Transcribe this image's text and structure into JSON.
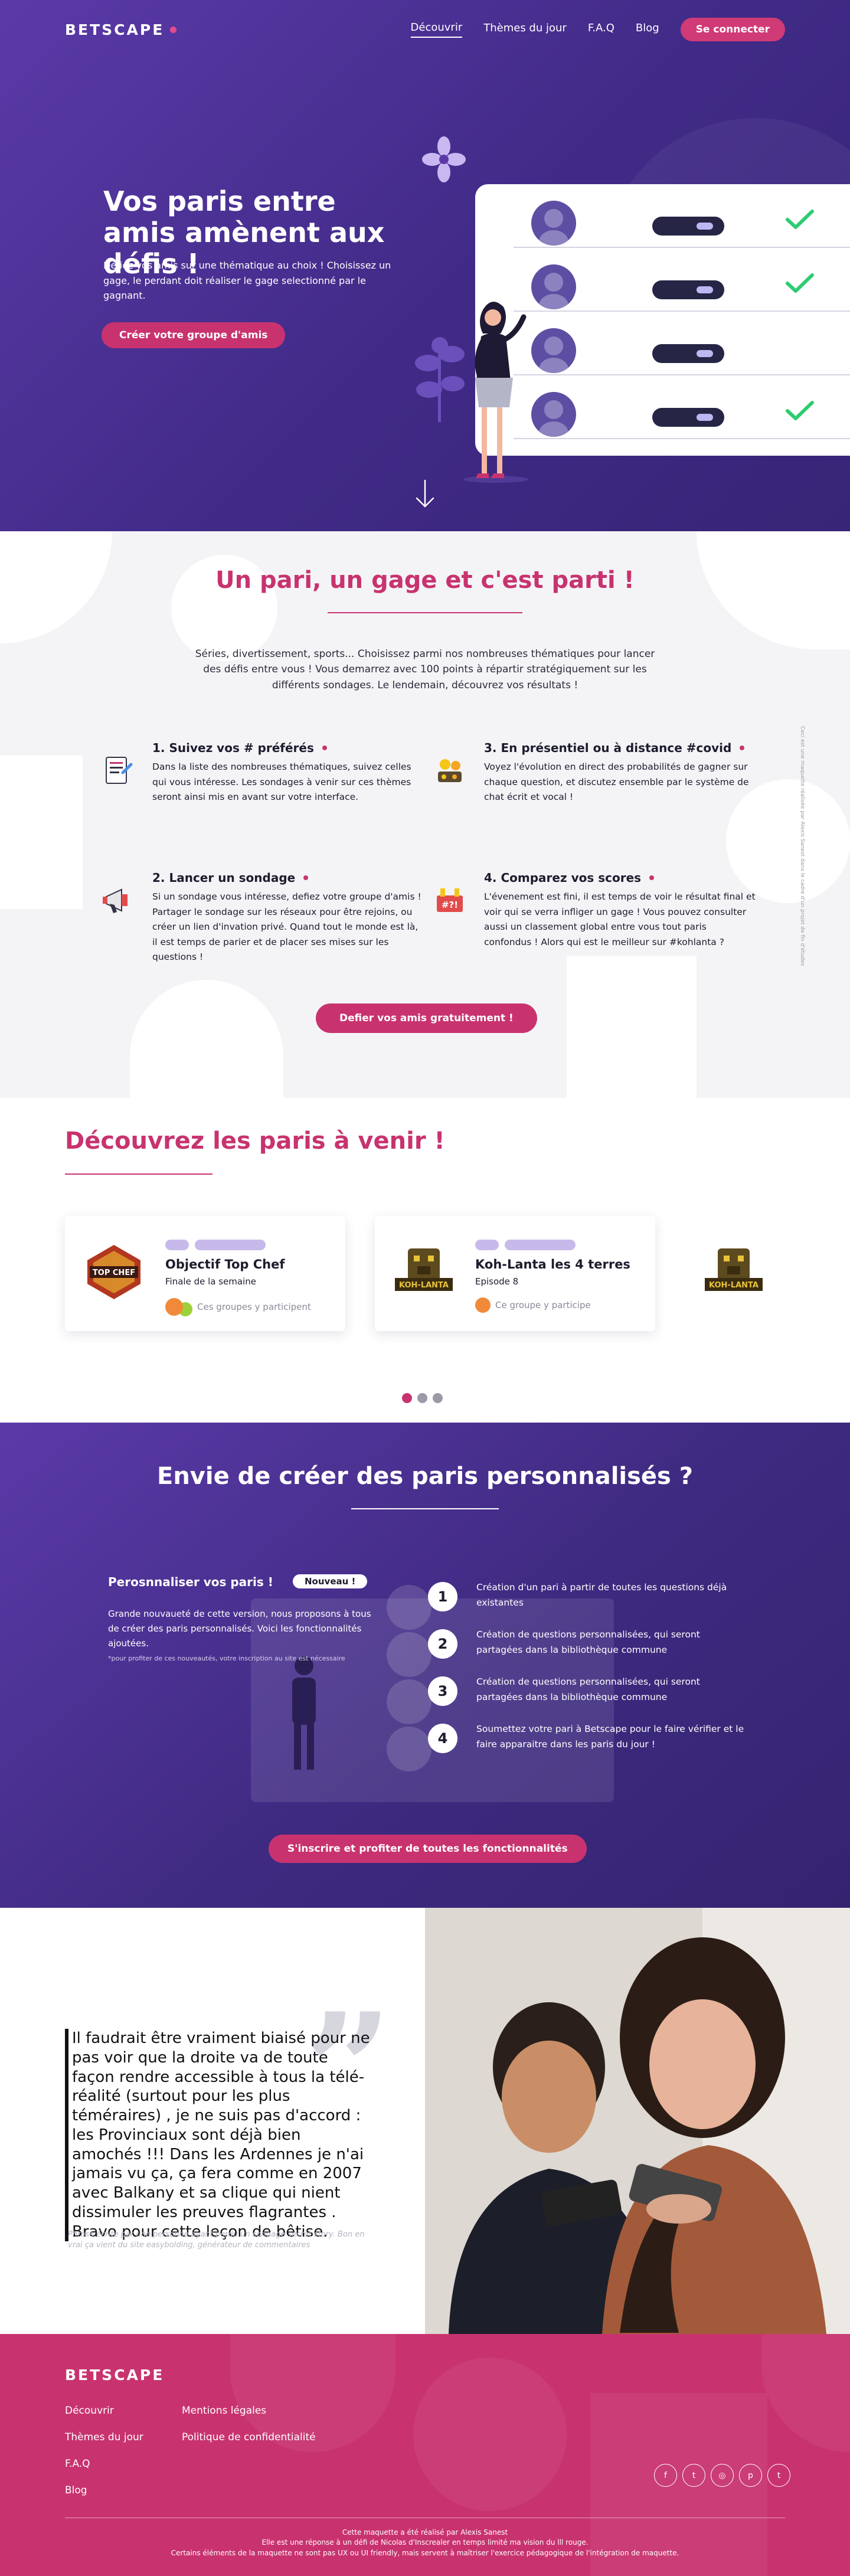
{
  "nav": {
    "logo": "BETSCAPE",
    "links": [
      "Découvrir",
      "Thèmes du jour",
      "F.A.Q",
      "Blog"
    ],
    "cta": "Se connecter"
  },
  "hero": {
    "title": "Vos paris entre amis amènent aux défis !",
    "subtitle": "Défiez vos amis sur une thématique au choix ! Choisissez un gage, le perdant doit réaliser le gage selectionné par le gagnant.",
    "cta": "Créer votre groupe d'amis"
  },
  "features": {
    "title": "Un pari, un gage et c'est parti !",
    "intro": "Séries, divertissement, sports... Choisissez parmi nos nombreuses thématiques pour lancer des défis entre vous ! Vous demarrez avec 100 points à répartir stratégiquement sur les différents sondages. Le lendemain, découvrez vos résultats !",
    "steps": [
      {
        "title": "1. Suivez vos # préférés",
        "text": "Dans la liste des nombreuses thématiques, suivez celles qui vous intéresse. Les sondages à venir sur ces thèmes seront ainsi mis en avant sur votre interface."
      },
      {
        "title": "2. Lancer un sondage",
        "text": "Si un sondage vous intéresse, defiez votre groupe d'amis ! Partager le sondage sur les réseaux pour être rejoins, ou créer un lien d'invation privé. Quand tout le monde est là, il est temps de parier et de placer ses mises sur les questions !"
      },
      {
        "title": "3. En présentiel ou à distance #covid",
        "text": "Voyez l'évolution en direct des probabilités de gagner sur chaque question, et discutez ensemble par le système de chat écrit et vocal !"
      },
      {
        "title": "4. Comparez vos scores",
        "text": "L'évenement est fini, il est temps de voir le résultat final et voir qui se verra infliger un gage ! Vous pouvez consulter aussi un classement global entre vous tout paris confondus ! Alors qui est le meilleur sur #kohlanta ?"
      }
    ],
    "vertical_note": "Ceci est une maquette réalisée par Alexis Sanest dans le cadre d'un projet de fin d'études",
    "cta": "Defier vos amis gratuitement !"
  },
  "upcoming": {
    "title": "Découvrez les paris à venir !",
    "cards": [
      {
        "thumb_text": "TOP CHEF",
        "title": "Objectif Top Chef",
        "subtitle": "Finale de la semaine",
        "meta": "Ces groupes y participent"
      },
      {
        "thumb_text": "KOH-LANTA",
        "title": "Koh-Lanta les 4 terres",
        "subtitle": "Episode 8",
        "meta": "Ce groupe y participe"
      },
      {
        "thumb_text": "KOH-LANTA"
      }
    ]
  },
  "custom": {
    "title": "Envie de créer des paris personnalisés ?",
    "heading": "Perosnnaliser vos paris !",
    "badge": "Nouveau !",
    "desc": "Grande nouvaueté de cette version, nous proposons à tous de créer des paris personnalisés. Voici les fonctionnalités ajoutées.",
    "note": "*pour profiter de ces nouveautés, votre inscription au site est nécessaire",
    "steps": [
      {
        "num": "1",
        "text": "Création d'un pari à partir de toutes les questions déjà existantes"
      },
      {
        "num": "2",
        "text": "Création de questions personnalisées, qui seront partagées dans la bibliothèque commune"
      },
      {
        "num": "3",
        "text": "Création de questions personnalisées, qui seront partagées dans la bibliothèque commune"
      },
      {
        "num": "4",
        "text": "Soumettez votre pari à Betscape pour le faire vérifier et le faire apparaitre dans les paris du jour !"
      }
    ],
    "cta": "S'inscrire et profiter de toutes les fonctionnalités"
  },
  "quote": {
    "text": "Il faudrait être vraiment biaisé pour ne pas voir que la droite va de toute façon rendre accessible à tous la télé-réalité (surtout pour les plus téméraires) , je ne suis pas d'accord : les Provinciaux sont déjà bien amochés !!! Dans les Ardennes je n'ai jamais vu ça, ça fera comme en 2007 avec Balkany et sa clique qui nient dissimuler les preuves flagrantes . Bravo pour cette leçon de bêtise.",
    "footnote": "Phrase écrite par une personne ayant perdu un sondage secret story. Bon en vrai ça vient du site easybolding, générateur de commentaires"
  },
  "footer": {
    "logo": "BETSCAPE",
    "links": [
      "Découvrir",
      "Mentions légales",
      "Thèmes du jour",
      "Politique de confidentialité",
      "F.A.Q",
      "",
      "Blog",
      ""
    ],
    "socials": [
      "f",
      "t",
      "◎",
      "p",
      "t"
    ],
    "credits": [
      "Cette maquette a été réalisé par Alexis Sanest",
      "Elle est une réponse à un défi de Nicolas d'Inscrealer en temps limité ma vision du lll rouge.",
      "Certains éléments de la maquette ne sont pas UX ou UI friendly, mais servent à maîtriser l'exercice pédagogique de l'intégration de maquette."
    ]
  },
  "colors": {
    "brand_pink": "#c8336f",
    "hero_purple": "#4a2f96",
    "accent_green": "#2ecc71"
  }
}
